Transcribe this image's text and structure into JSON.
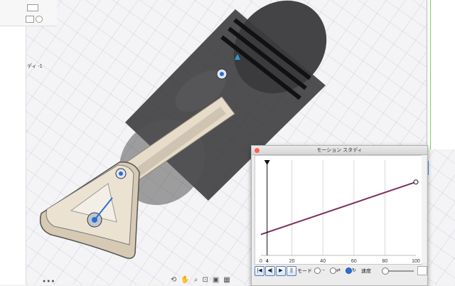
{
  "viewport": {
    "sidebar_label": "ディ -1"
  },
  "motion_study": {
    "title": "モーション スタディ",
    "controls": {
      "mode_label": "モード",
      "speed_label": "速度"
    }
  },
  "chart_data": {
    "type": "line",
    "x_ticks": [
      "0",
      "4",
      "20",
      "40",
      "60",
      "80",
      "100"
    ],
    "xlim": [
      0,
      100
    ],
    "series": [
      {
        "x": [
          0,
          100
        ],
        "y": [
          0.0,
          1.0
        ]
      }
    ],
    "playhead": 4,
    "grid": true,
    "colors": {
      "line": "#7c2f63",
      "playhead": "#111111"
    }
  },
  "colors": {
    "accent": "#2a6fd6",
    "grid_green": "#7fd15a",
    "body": "#2b2b2d",
    "crank": "#e7ddcc"
  }
}
